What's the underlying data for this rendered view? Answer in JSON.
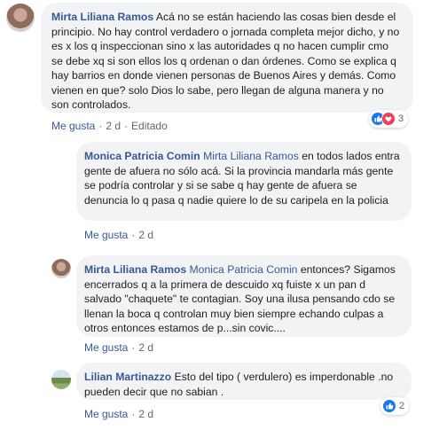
{
  "comments": [
    {
      "author": "Mirta Liliana Ramos",
      "mention": "",
      "text": " Acá no se están haciendo las cosas bien desde el principio. No hay control verdadero o jornada completa mejor dicho, y no es x los q inspeccionan sino x las autoridades q no hacen cumplir cmo se debe xq si son ellos los q ordenan o dan órdenes. Como se explica q hay barrios en donde vienen personas de Buenos Aires y demás. Como vienen en que? solo Dios lo sabe, pero llegan de alguna manera y no son controlados.",
      "like_label": "Me gusta",
      "time": "2 d",
      "edited": "Editado",
      "reactions": {
        "count": "3",
        "icons": [
          "like-icon",
          "love-icon"
        ]
      }
    },
    {
      "author": "Monica Patricia Comin",
      "mention": "Mirta Liliana Ramos",
      "text": " en todos lados entra gente de afuera no sólo acá. Si la provincia mandarla más gente se podría controlar y si se sabe q hay gente de afuera se denuncia lo q pasa q nadie quiere lo de su caripela en la policia",
      "like_label": "Me gusta",
      "time": "2 d"
    },
    {
      "author": "Mirta Liliana Ramos",
      "mention": "Monica Patricia Comin",
      "text": " entonces? Sigamos encerrados q a la primera de descuido xq fuiste x un pan d salvado \"chaquete\" te contagian. Soy una ilusa pensando cdo se llenan la boca q controlan muy bien siempre echando culpas a otros entonces estamos de p...sin covic....",
      "like_label": "Me gusta",
      "time": "2 d"
    },
    {
      "author": "Lilian Martinazzo",
      "mention": "",
      "text": " Esto del tipo ( verdulero) es imperdonable .no pueden decir que no sabian .",
      "like_label": "Me gusta",
      "time": "2 d",
      "reactions": {
        "count": "2",
        "icons": [
          "like-icon"
        ]
      }
    }
  ],
  "colors": {
    "link": "#385898",
    "bubble": "#f2f3f5",
    "like": "#1877f2",
    "love": "#f33e58"
  }
}
